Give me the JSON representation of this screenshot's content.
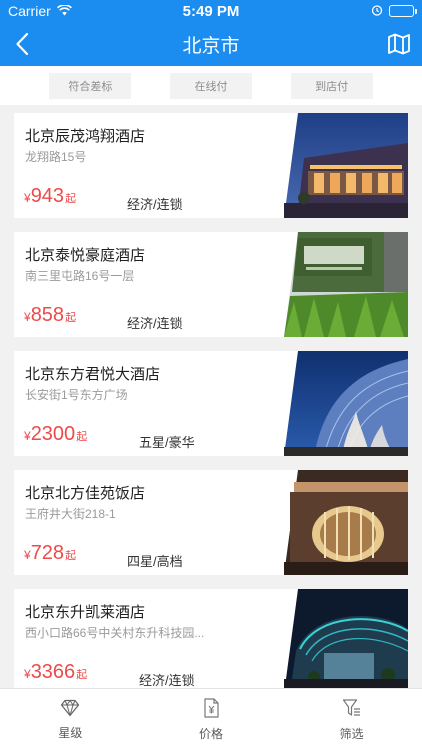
{
  "status": {
    "carrier": "Carrier",
    "time": "5:49 PM"
  },
  "nav": {
    "title": "北京市"
  },
  "filters": [
    "符合差标",
    "在线付",
    "到店付"
  ],
  "hotels": [
    {
      "name": "北京辰茂鸿翔酒店",
      "address": "龙翔路15号",
      "currency": "¥",
      "price": "943",
      "suffix": "起",
      "tag": "经济/连锁"
    },
    {
      "name": "北京泰悦豪庭酒店",
      "address": "南三里屯路16号一层",
      "currency": "¥",
      "price": "858",
      "suffix": "起",
      "tag": "经济/连锁"
    },
    {
      "name": "北京东方君悦大酒店",
      "address": "长安街1号东方广场",
      "currency": "¥",
      "price": "2300",
      "suffix": "起",
      "tag": "五星/豪华"
    },
    {
      "name": "北京北方佳苑饭店",
      "address": "王府井大街218-1",
      "currency": "¥",
      "price": "728",
      "suffix": "起",
      "tag": "四星/高档"
    },
    {
      "name": "北京东升凯莱酒店",
      "address": "西小口路66号中关村东升科技园...",
      "currency": "¥",
      "price": "3366",
      "suffix": "起",
      "tag": "经济/连锁"
    }
  ],
  "tabs": [
    {
      "label": "星级",
      "icon": "diamond-icon"
    },
    {
      "label": "价格",
      "icon": "price-tag-icon"
    },
    {
      "label": "筛选",
      "icon": "filter-icon"
    }
  ],
  "colors": {
    "primary": "#1b8cf0",
    "price": "#ee4a4a",
    "background": "#f1f1f1"
  }
}
